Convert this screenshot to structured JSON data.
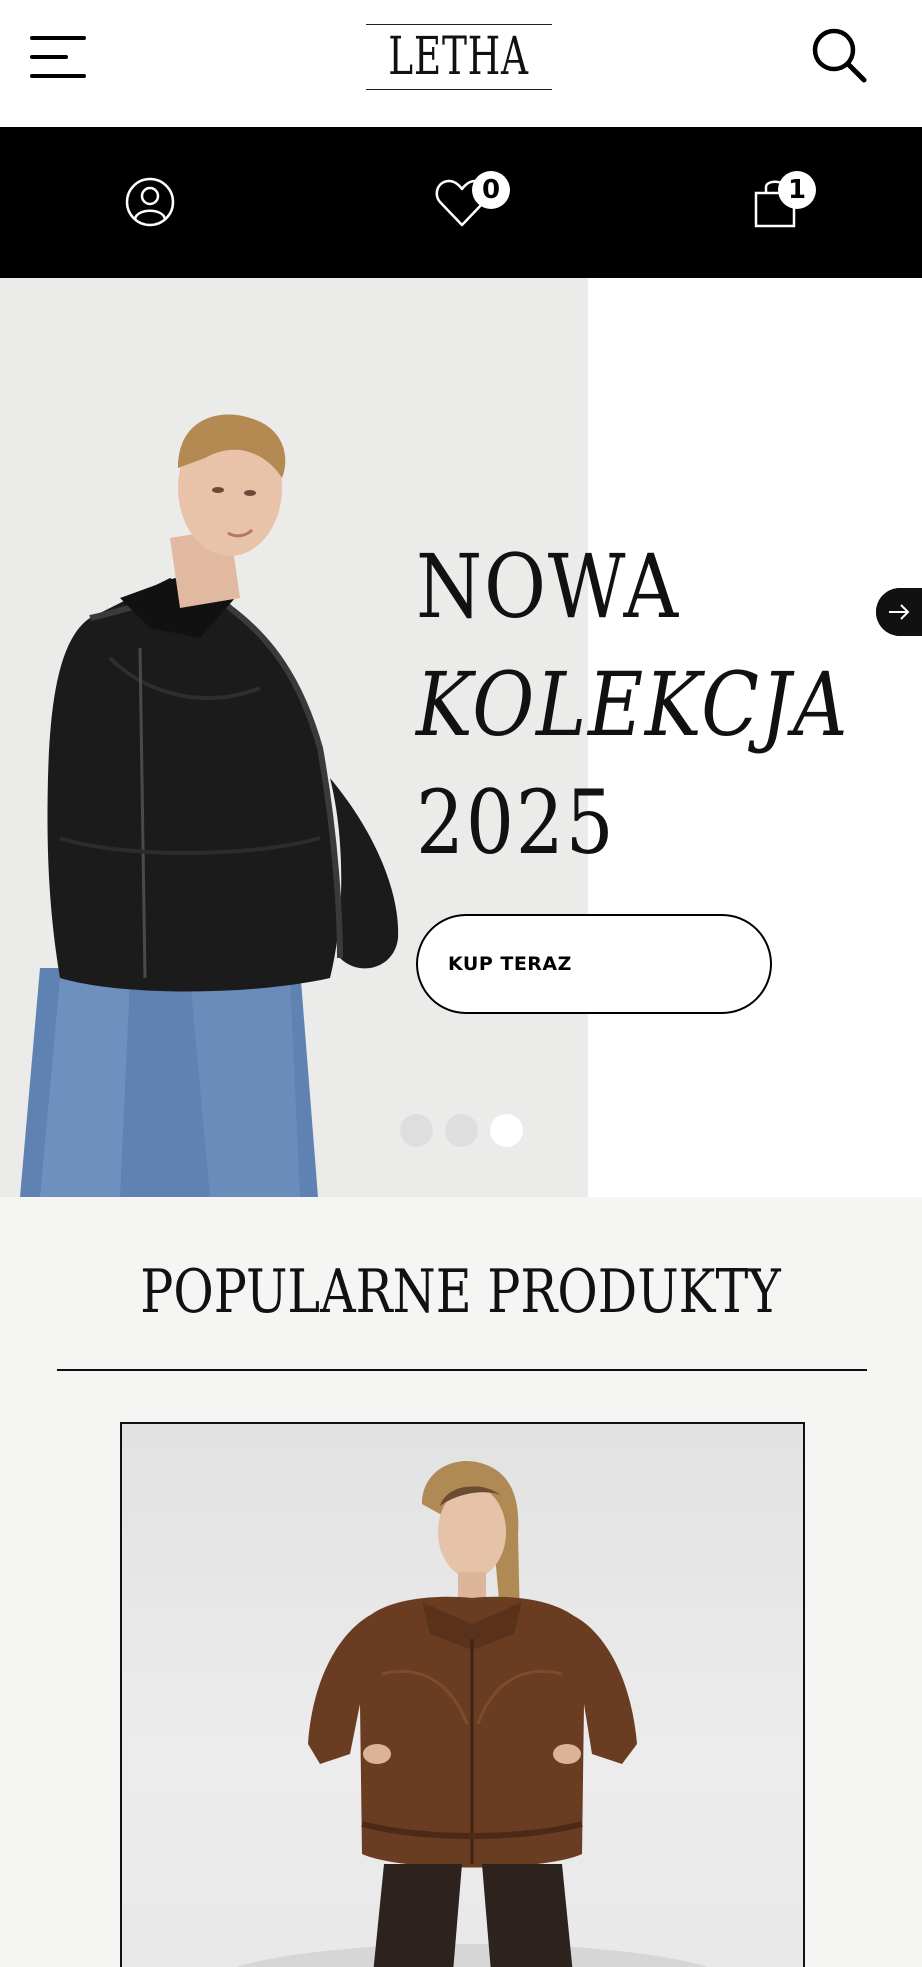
{
  "header": {
    "logo_text": "LETHA",
    "menu_icon": "hamburger-menu-icon",
    "search_icon": "search-icon"
  },
  "iconbar": {
    "account_icon": "user-icon",
    "wishlist_icon": "heart-icon",
    "wishlist_count": "0",
    "cart_icon": "shopping-bag-icon",
    "cart_count": "1"
  },
  "hero": {
    "title_line1": "NOWA",
    "title_line2": "KOLEKCJA",
    "title_line3": "2025",
    "cta_label": "KUP TERAZ",
    "next_icon": "arrow-right-icon",
    "slides_total": 3,
    "active_slide": 3
  },
  "popular": {
    "title": "POPULARNE PRODUKTY"
  }
}
